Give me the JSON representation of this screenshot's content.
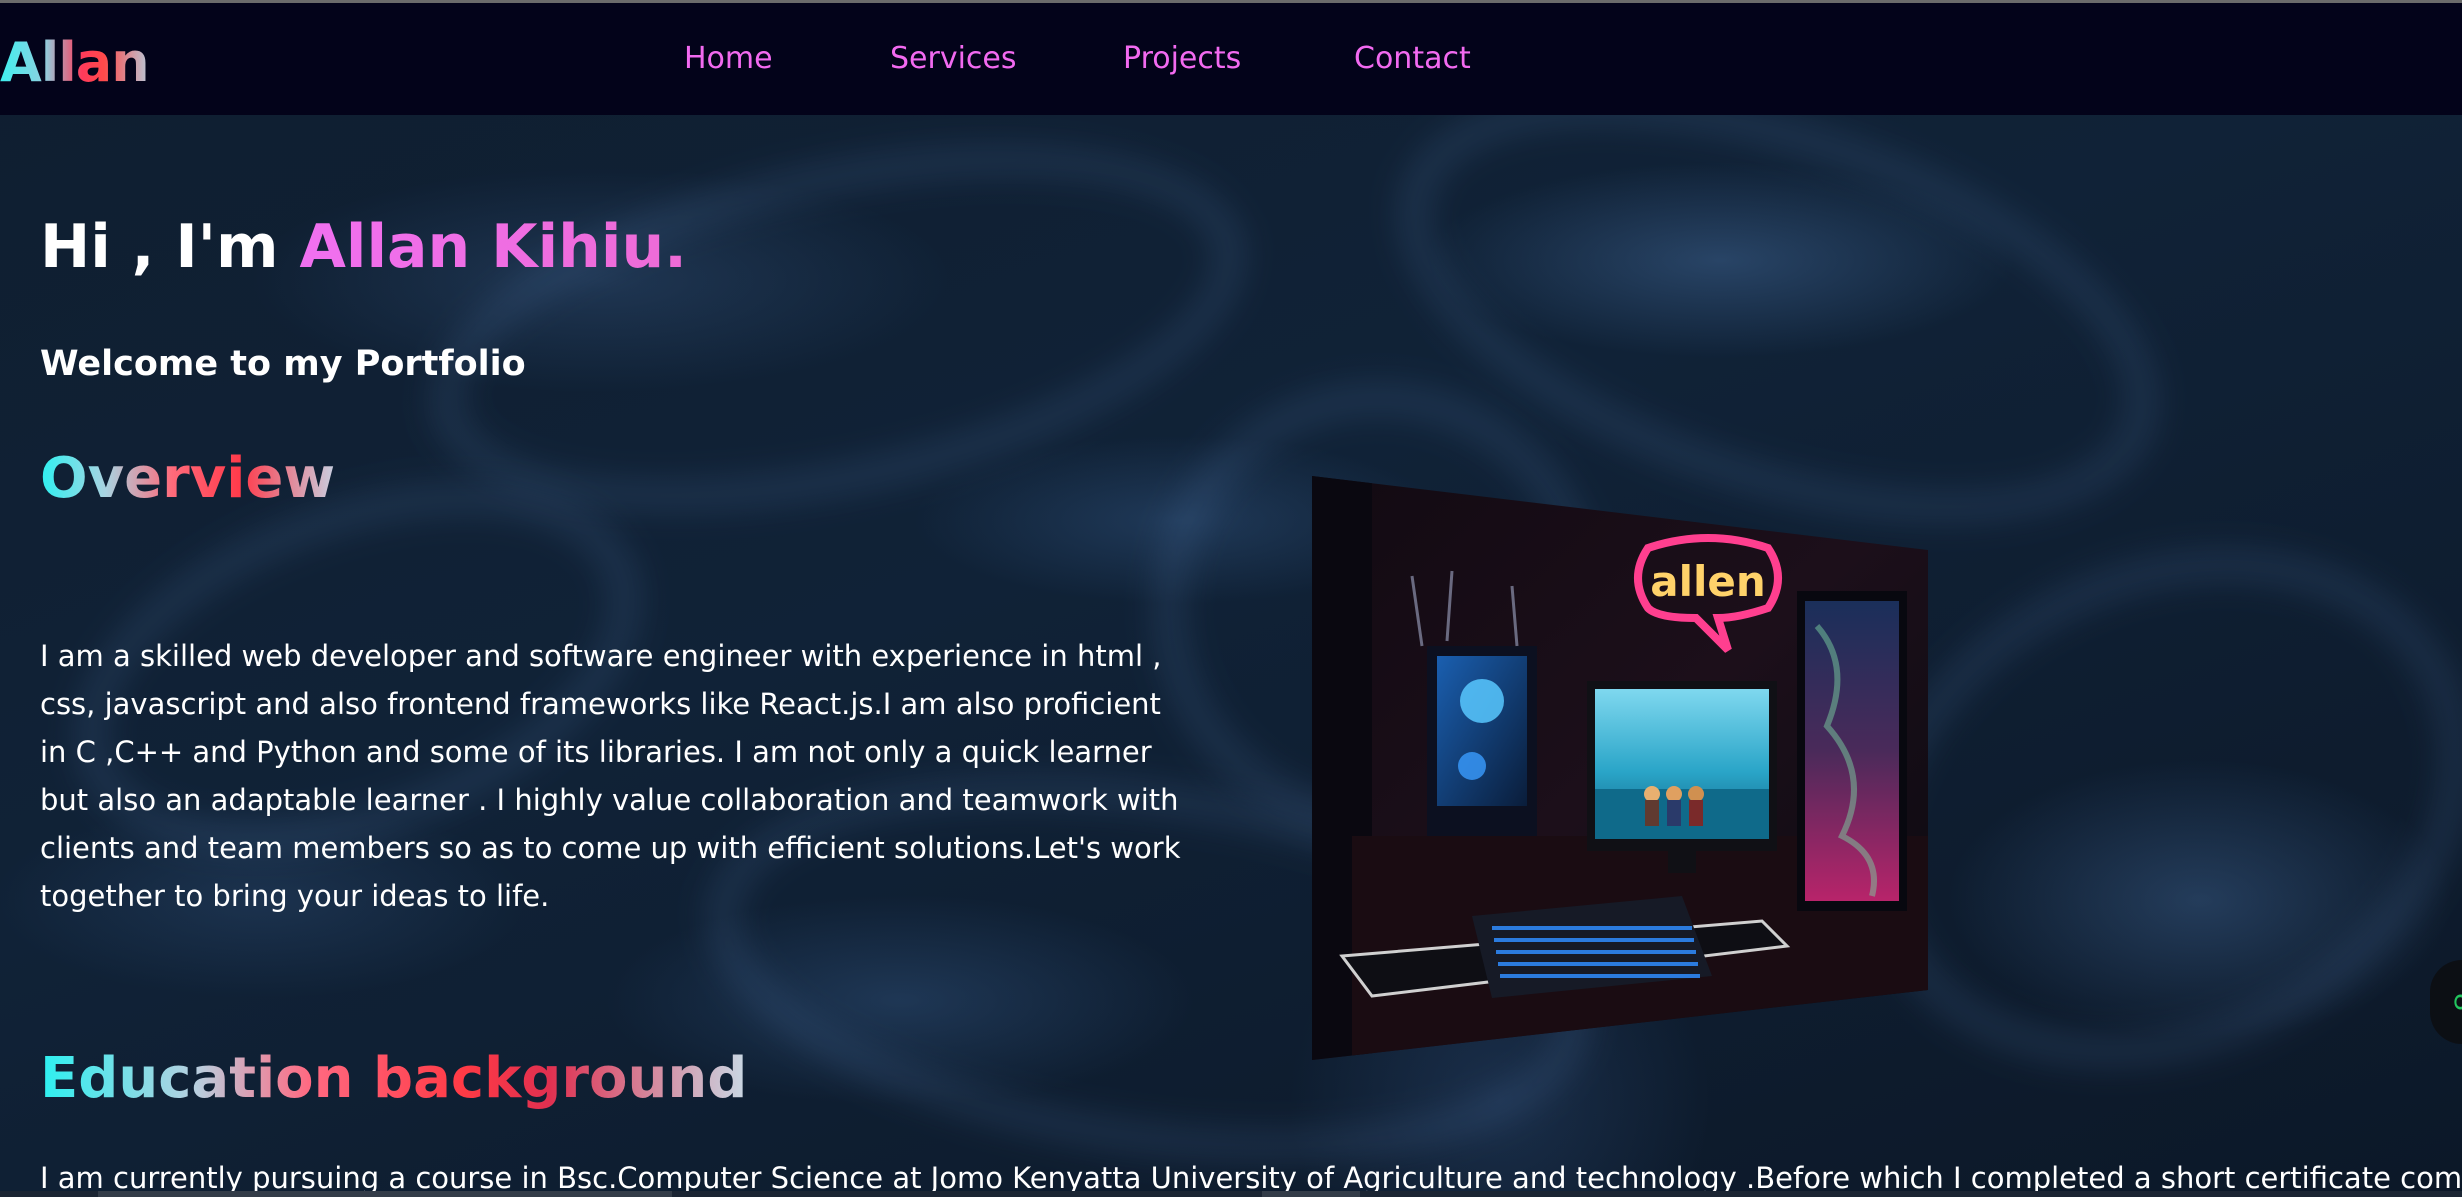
{
  "nav": {
    "logo": "Allan",
    "links": [
      "Home",
      "Services",
      "Projects",
      "Contact"
    ]
  },
  "hero": {
    "greeting": "Hi , I'm ",
    "name": "Allan Kihiu.",
    "welcome": "Welcome to my Portfolio"
  },
  "overview": {
    "title": "Overview",
    "text": "I am a skilled web developer and software engineer with experience in html , css, javascript and also frontend frameworks like React.js.I am also proficient in C ,C++ and Python and some of its libraries. I am not only a quick learner but also an adaptable learner . I highly value collaboration and teamwork with clients and team members so as to come up with efficient solutions.Let's work together to bring your ideas to life."
  },
  "education": {
    "title": "Education background",
    "text": "I am currently pursuing a course in Bsc.Computer Science at Jomo Kenyatta University of Agriculture and technology .Before which I completed a short certificate computer"
  },
  "photo": {
    "neon_sign": "allen"
  },
  "colors": {
    "nav_bg": "#03031a",
    "nav_link": "#f26af0",
    "page_bg": "#102237",
    "name_accent": "#f070f0",
    "widget_icon": "#22c55e"
  },
  "icons": {
    "side_widget": "chat-widget-icon"
  }
}
